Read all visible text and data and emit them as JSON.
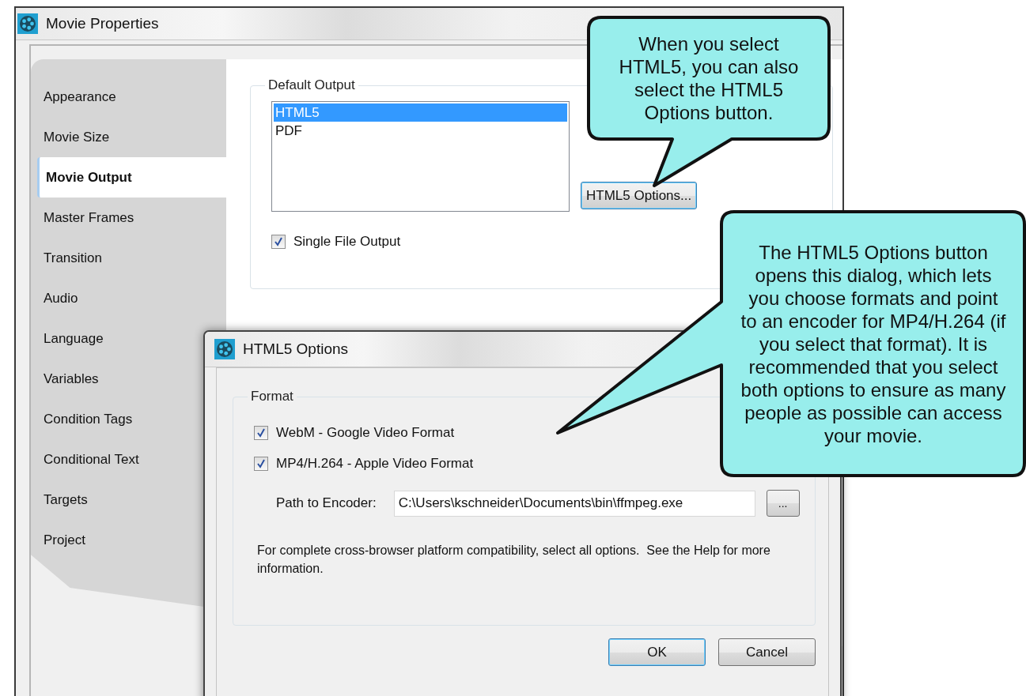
{
  "main_window": {
    "title": "Movie Properties",
    "sidebar": {
      "items": [
        {
          "label": "Appearance",
          "selected": false
        },
        {
          "label": "Movie Size",
          "selected": false
        },
        {
          "label": "Movie Output",
          "selected": true
        },
        {
          "label": "Master Frames",
          "selected": false
        },
        {
          "label": "Transition",
          "selected": false
        },
        {
          "label": "Audio",
          "selected": false
        },
        {
          "label": "Language",
          "selected": false
        },
        {
          "label": "Variables",
          "selected": false
        },
        {
          "label": "Condition Tags",
          "selected": false
        },
        {
          "label": "Conditional Text",
          "selected": false
        },
        {
          "label": "Targets",
          "selected": false
        },
        {
          "label": "Project",
          "selected": false
        }
      ]
    },
    "default_output": {
      "label": "Default Output",
      "list": [
        {
          "label": "HTML5",
          "selected": true
        },
        {
          "label": "PDF",
          "selected": false
        }
      ],
      "options_button": "HTML5 Options...",
      "single_file_output": {
        "label": "Single File Output",
        "checked": true
      }
    }
  },
  "dialog": {
    "title": "HTML5 Options",
    "format": {
      "label": "Format",
      "options": [
        {
          "label": "WebM - Google Video Format",
          "checked": true
        },
        {
          "label": "MP4/H.264 - Apple Video Format",
          "checked": true
        }
      ],
      "path_label": "Path to Encoder:",
      "path_value": "C:\\Users\\kschneider\\Documents\\bin\\ffmpeg.exe",
      "browse_button": "...",
      "note": "For complete cross-browser platform compatibility, select all options.  See the Help for more information."
    },
    "buttons": [
      {
        "label": "OK",
        "default": true
      },
      {
        "label": "Cancel",
        "default": false
      }
    ]
  },
  "callouts": [
    {
      "text": "When you select HTML5, you can also select the HTML5 Options button."
    },
    {
      "text": "The HTML5 Options button opens this dialog, which lets you choose formats and point to an encoder for MP4/H.264 (if you select that format). It is recommended that you select both options to ensure as many people as possible can access your movie."
    }
  ]
}
